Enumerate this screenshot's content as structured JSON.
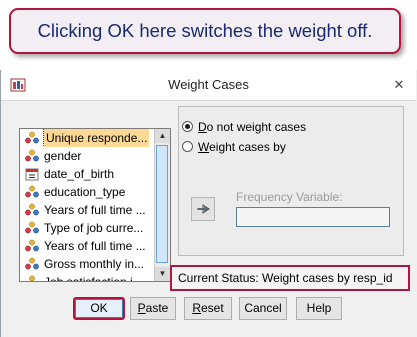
{
  "callout": {
    "text": "Clicking OK here switches the weight off."
  },
  "window": {
    "title": "Weight Cases",
    "close_glyph": "✕"
  },
  "variables": {
    "items": [
      {
        "label": "Unique responde...",
        "icon": "nominal-variable-icon"
      },
      {
        "label": "gender",
        "icon": "nominal-variable-icon"
      },
      {
        "label": "date_of_birth",
        "icon": "date-variable-icon"
      },
      {
        "label": "education_type",
        "icon": "nominal-variable-icon"
      },
      {
        "label": "Years of full time ...",
        "icon": "nominal-variable-icon"
      },
      {
        "label": "Type of job curre...",
        "icon": "nominal-variable-icon"
      },
      {
        "label": "Years of full time ...",
        "icon": "nominal-variable-icon"
      },
      {
        "label": "Gross monthly in...",
        "icon": "nominal-variable-icon"
      },
      {
        "label": "Job satisfaction i...",
        "icon": "nominal-variable-icon"
      }
    ],
    "selected_index": 0
  },
  "options": {
    "do_not_weight": {
      "hotkey": "D",
      "rest": "o not weight cases",
      "checked": true
    },
    "weight_by": {
      "hotkey": "W",
      "rest": "eight cases by",
      "checked": false
    },
    "frequency_label": "Frequency Variable:",
    "frequency_value": ""
  },
  "status": {
    "text": "Current Status: Weight cases by resp_id"
  },
  "buttons": {
    "ok": {
      "label": "OK"
    },
    "paste": {
      "hotkey": "P",
      "rest": "aste"
    },
    "reset": {
      "hotkey": "R",
      "rest": "eset"
    },
    "cancel": {
      "label": "Cancel"
    },
    "help": {
      "label": "Help"
    }
  },
  "colors": {
    "highlight": "#b0163e",
    "callout_text": "#1b2a6e",
    "selection": "#fdd995"
  }
}
